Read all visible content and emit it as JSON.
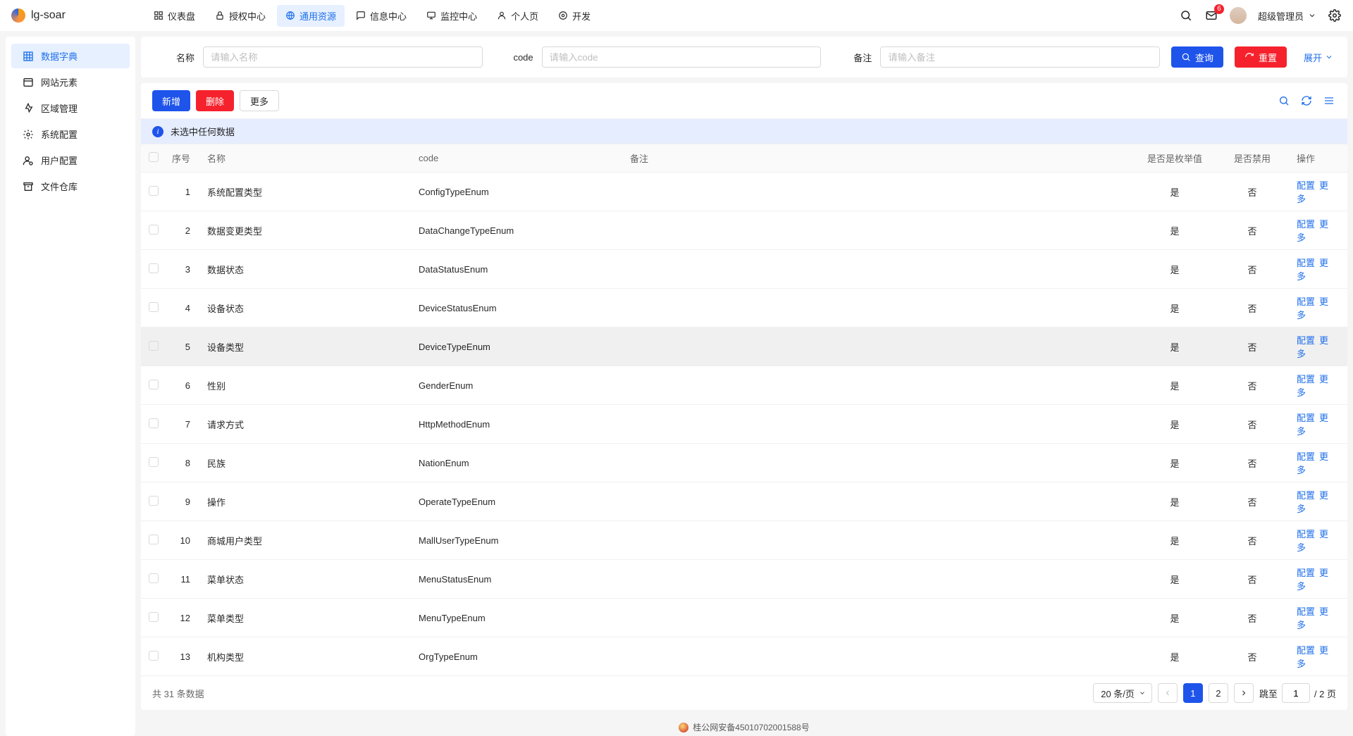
{
  "header": {
    "app_name": "lg-soar",
    "menu": [
      {
        "icon": "dashboard-icon",
        "label": "仪表盘"
      },
      {
        "icon": "lock-icon",
        "label": "授权中心"
      },
      {
        "icon": "globe-icon",
        "label": "通用资源",
        "active": true
      },
      {
        "icon": "chat-icon",
        "label": "信息中心"
      },
      {
        "icon": "monitor-icon",
        "label": "监控中心"
      },
      {
        "icon": "user-icon",
        "label": "个人页"
      },
      {
        "icon": "dev-icon",
        "label": "开发"
      }
    ],
    "notification_count": "6",
    "user_name": "超级管理员"
  },
  "sidebar": {
    "items": [
      {
        "icon": "grid-icon",
        "label": "数据字典",
        "active": true
      },
      {
        "icon": "webpage-icon",
        "label": "网站元素"
      },
      {
        "icon": "pin-icon",
        "label": "区域管理"
      },
      {
        "icon": "gear-icon",
        "label": "系统配置"
      },
      {
        "icon": "user-config-icon",
        "label": "用户配置"
      },
      {
        "icon": "archive-icon",
        "label": "文件仓库"
      }
    ]
  },
  "search": {
    "fields": [
      {
        "label": "名称",
        "placeholder": "请输入名称"
      },
      {
        "label": "code",
        "placeholder": "请输入code"
      },
      {
        "label": "备注",
        "placeholder": "请输入备注"
      }
    ],
    "query_btn": "查询",
    "reset_btn": "重置",
    "expand": "展开"
  },
  "toolbar": {
    "add": "新增",
    "delete": "删除",
    "more": "更多"
  },
  "alert": "未选中任何数据",
  "table": {
    "columns": [
      "序号",
      "名称",
      "code",
      "备注",
      "是否是枚举值",
      "是否禁用",
      "操作"
    ],
    "rows": [
      {
        "idx": 1,
        "name": "系统配置类型",
        "code": "ConfigTypeEnum",
        "remark": "",
        "isEnum": "是",
        "disabled": "否"
      },
      {
        "idx": 2,
        "name": "数据变更类型",
        "code": "DataChangeTypeEnum",
        "remark": "",
        "isEnum": "是",
        "disabled": "否"
      },
      {
        "idx": 3,
        "name": "数据状态",
        "code": "DataStatusEnum",
        "remark": "",
        "isEnum": "是",
        "disabled": "否"
      },
      {
        "idx": 4,
        "name": "设备状态",
        "code": "DeviceStatusEnum",
        "remark": "",
        "isEnum": "是",
        "disabled": "否"
      },
      {
        "idx": 5,
        "name": "设备类型",
        "code": "DeviceTypeEnum",
        "remark": "",
        "isEnum": "是",
        "disabled": "否",
        "highlight": true
      },
      {
        "idx": 6,
        "name": "性别",
        "code": "GenderEnum",
        "remark": "",
        "isEnum": "是",
        "disabled": "否"
      },
      {
        "idx": 7,
        "name": "请求方式",
        "code": "HttpMethodEnum",
        "remark": "",
        "isEnum": "是",
        "disabled": "否"
      },
      {
        "idx": 8,
        "name": "民族",
        "code": "NationEnum",
        "remark": "",
        "isEnum": "是",
        "disabled": "否"
      },
      {
        "idx": 9,
        "name": "操作",
        "code": "OperateTypeEnum",
        "remark": "",
        "isEnum": "是",
        "disabled": "否"
      },
      {
        "idx": 10,
        "name": "商城用户类型",
        "code": "MallUserTypeEnum",
        "remark": "",
        "isEnum": "是",
        "disabled": "否"
      },
      {
        "idx": 11,
        "name": "菜单状态",
        "code": "MenuStatusEnum",
        "remark": "",
        "isEnum": "是",
        "disabled": "否"
      },
      {
        "idx": 12,
        "name": "菜单类型",
        "code": "MenuTypeEnum",
        "remark": "",
        "isEnum": "是",
        "disabled": "否"
      },
      {
        "idx": 13,
        "name": "机构类型",
        "code": "OrgTypeEnum",
        "remark": "",
        "isEnum": "是",
        "disabled": "否"
      }
    ],
    "op_config": "配置",
    "op_more": "更多"
  },
  "pagination": {
    "total_text": "共 31 条数据",
    "page_size": "20 条/页",
    "pages": [
      "1",
      "2"
    ],
    "current": 1,
    "jump_label": "跳至",
    "jump_value": "1",
    "jump_suffix": "/ 2 页"
  },
  "footer": "桂公网安备45010702001588号"
}
